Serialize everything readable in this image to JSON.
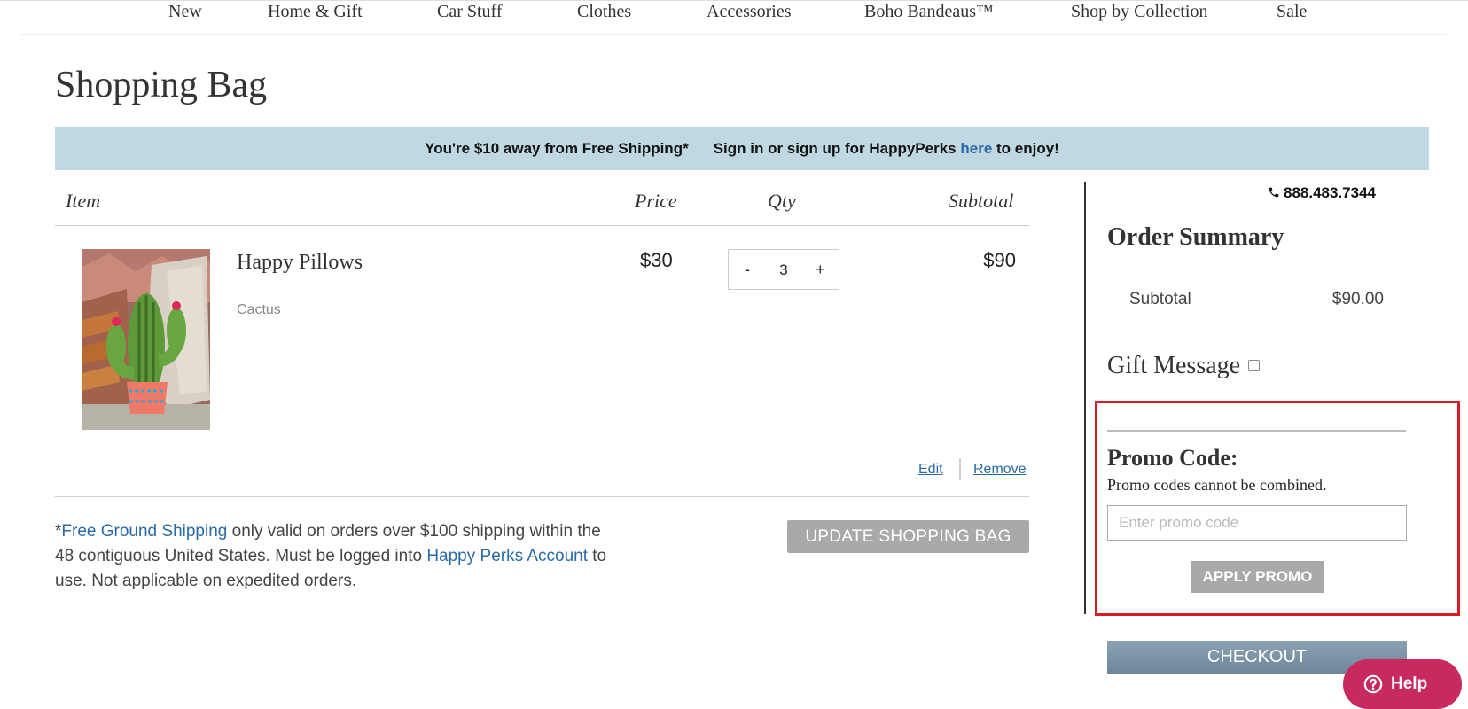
{
  "nav": {
    "items": [
      "New",
      "Home & Gift",
      "Car Stuff",
      "Clothes",
      "Accessories",
      "Boho Bandeaus™",
      "Shop by Collection",
      "Sale"
    ]
  },
  "page_title": "Shopping Bag",
  "banner": {
    "shipping_text": "You're $10 away from Free Shipping*",
    "perks_prefix": "Sign in or sign up for HappyPerks ",
    "perks_link": "here",
    "perks_suffix": " to enjoy!"
  },
  "cart": {
    "headers": {
      "item": "Item",
      "price": "Price",
      "qty": "Qty",
      "subtotal": "Subtotal"
    },
    "items": [
      {
        "name": "Happy Pillows",
        "variant": "Cactus",
        "image": "cactus-pillow-image",
        "price": "$30",
        "qty": "3",
        "qty_minus": "-",
        "qty_plus": "+",
        "subtotal": "$90",
        "edit_label": "Edit",
        "remove_label": "Remove"
      }
    ],
    "note": {
      "prefix": "*",
      "link1": "Free Ground Shipping",
      "mid": " only valid on orders over $100 shipping within the 48 contiguous United States. Must be logged into ",
      "link2": "Happy Perks Account",
      "suffix": " to use. Not applicable on expedited orders."
    },
    "update_label": "UPDATE SHOPPING BAG"
  },
  "sidebar": {
    "phone_icon": "phone-icon",
    "phone": "888.483.7344",
    "order_summary_title": "Order Summary",
    "subtotal_label": "Subtotal",
    "subtotal_value": "$90.00",
    "gift_message_label": "Gift Message",
    "gift_message_checked": false,
    "promo": {
      "title": "Promo Code:",
      "subtitle": "Promo codes cannot be combined.",
      "placeholder": "Enter promo code",
      "value": "",
      "apply_label": "APPLY PROMO",
      "highlight_color": "#d91c24"
    },
    "checkout_label": "CHECKOUT"
  },
  "help": {
    "icon": "question-circle-icon",
    "label": "Help",
    "color": "#c8295f"
  },
  "colors": {
    "banner_bg": "#bfd8e1",
    "link": "#2a6aa6",
    "button_gray": "#a9a9a9"
  }
}
